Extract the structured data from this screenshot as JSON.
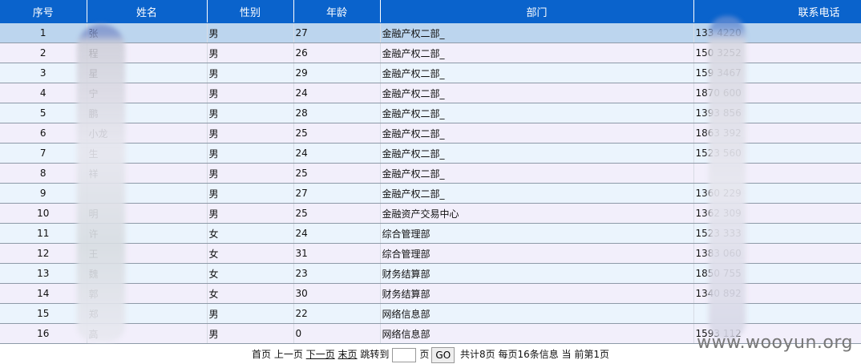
{
  "columns": [
    "序号",
    "姓名",
    "性别",
    "年龄",
    "部门",
    "联系电话"
  ],
  "rows": [
    {
      "no": "1",
      "name": "张",
      "gender": "男",
      "age": "27",
      "dept": "金融产权二部_",
      "phone": "133    4220"
    },
    {
      "no": "2",
      "name": "程",
      "gender": "男",
      "age": "26",
      "dept": "金融产权二部_",
      "phone": "150    3252"
    },
    {
      "no": "3",
      "name": "  星",
      "gender": "男",
      "age": "29",
      "dept": "金融产权二部_",
      "phone": "159    3467"
    },
    {
      "no": "4",
      "name": "  宁",
      "gender": "男",
      "age": "24",
      "dept": "金融产权二部_",
      "phone": "1870    600"
    },
    {
      "no": "5",
      "name": "  鹏",
      "gender": "男",
      "age": "28",
      "dept": "金融产权二部_",
      "phone": "1393    856"
    },
    {
      "no": "6",
      "name": "小龙",
      "gender": "男",
      "age": "25",
      "dept": "金融产权二部_",
      "phone": "1863    392"
    },
    {
      "no": "7",
      "name": "  生",
      "gender": "男",
      "age": "24",
      "dept": "金融产权二部_",
      "phone": "1523    560"
    },
    {
      "no": "8",
      "name": "  祥",
      "gender": "男",
      "age": "25",
      "dept": "金融产权二部_",
      "phone": ""
    },
    {
      "no": "9",
      "name": "",
      "gender": "男",
      "age": "27",
      "dept": "金融产权二部_",
      "phone": "1360    229"
    },
    {
      "no": "10",
      "name": "  明",
      "gender": "男",
      "age": "25",
      "dept": "金融资产交易中心",
      "phone": "1362    309"
    },
    {
      "no": "11",
      "name": "许",
      "gender": "女",
      "age": "24",
      "dept": "综合管理部",
      "phone": "1523    333"
    },
    {
      "no": "12",
      "name": "王",
      "gender": "女",
      "age": "31",
      "dept": "综合管理部",
      "phone": "1383    060"
    },
    {
      "no": "13",
      "name": "魏",
      "gender": "女",
      "age": "23",
      "dept": "财务结算部",
      "phone": "1850    755"
    },
    {
      "no": "14",
      "name": "郭",
      "gender": "女",
      "age": "30",
      "dept": "财务结算部",
      "phone": "1340    892"
    },
    {
      "no": "15",
      "name": "郑",
      "gender": "男",
      "age": "22",
      "dept": "网络信息部",
      "phone": ""
    },
    {
      "no": "16",
      "name": "高",
      "gender": "男",
      "age": "0",
      "dept": "网络信息部",
      "phone": "1593    112"
    }
  ],
  "pager": {
    "first": "首页",
    "prev": "上一页",
    "next": "下一页",
    "last": "末页",
    "jump_label": "跳转到",
    "page_unit": "页",
    "go": "GO",
    "summary": "共计8页 每页16条信息 当 前第1页"
  },
  "watermark": "www.wooyun.org",
  "colors": {
    "header": "#0a63cc",
    "row_odd": "#ebf4fd",
    "row_even": "#f2effb",
    "selected": "#bcd5ee"
  }
}
